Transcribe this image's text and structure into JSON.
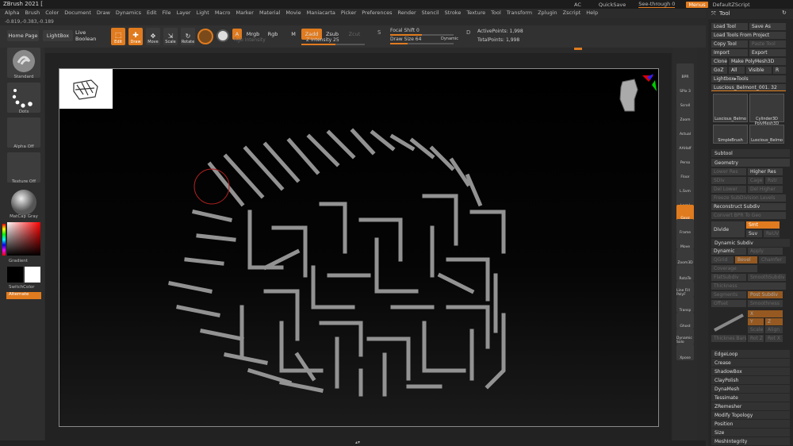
{
  "app": {
    "title": "ZBrush 2021 [",
    "coords": "-0.819,-0.383,-0.189"
  },
  "menus": [
    "Alpha",
    "Brush",
    "Color",
    "Document",
    "Draw",
    "Dynamics",
    "Edit",
    "File",
    "Layer",
    "Light",
    "Macro",
    "Marker",
    "Material",
    "Movie",
    "Maniacarta",
    "Picker",
    "Preferences",
    "Render",
    "Stencil",
    "Stroke",
    "Texture",
    "Tool",
    "Transform",
    "Zplugin",
    "Zscript",
    "Help"
  ],
  "topright": {
    "ac": "AC",
    "quicksave": "QuickSave",
    "seethrough": "See-through  0",
    "menus": "Menus",
    "script": "DefaultZScript"
  },
  "toolbar": {
    "home": "Home Page",
    "lightbox": "LightBox",
    "liveboolean": "Live Boolean",
    "edit": "Edit",
    "draw": "Draw",
    "move": "Move",
    "scale": "Scale",
    "rotate": "Rotate",
    "a": "A",
    "mrgb": "Mrgb",
    "rgb": "Rgb",
    "m": "M",
    "zadd": "Zadd",
    "zsub": "Zsub",
    "zcut": "Zcut",
    "rgb_intensity": "Rgb Intensity",
    "z_intensity": "Z Intensity 25",
    "focal_shift": "Focal Shift 0",
    "draw_size": "Draw Size 64",
    "dynamic": "Dynamic",
    "active_points": "ActivePoints: 1,998",
    "total_points": "TotalPoints: 1,998"
  },
  "leftshelf": {
    "standard": "Standard",
    "dots": "Dots",
    "alpha": "Alpha Off",
    "texture": "Texture Off",
    "matcap": "MatCap Gray",
    "gradient": "Gradient",
    "switchcolor": "SwitchColor",
    "alternate": "Alternate"
  },
  "rightshelf": [
    "BPR",
    "SPix 3",
    "Scroll",
    "Zoom",
    "Actual",
    "AAHalf",
    "Persp",
    "Floor",
    "L.Sym",
    "Local",
    "Gxyz",
    "Frame",
    "Move",
    "Zoom3D",
    "RotaTe",
    "Line Fill PolyF",
    "Transp",
    "Ghost",
    "Dynamic Solo",
    "Xpose"
  ],
  "toolpanel": {
    "header": "Tool",
    "load_tool": "Load Tool",
    "save_as": "Save As",
    "load_project": "Load Tools From Project",
    "copy_tool": "Copy Tool",
    "paste_tool": "Paste Tool",
    "import": "Import",
    "export": "Export",
    "clone": "Clone",
    "make_polymesh": "Make PolyMesh3D",
    "goz": "GoZ",
    "all": "All",
    "visible": "Visible",
    "r": "R",
    "lightbox_tools": "Lightbox▸Tools",
    "current_tool": "Luscious_Belmont_001. 32",
    "thumbs": [
      "Luscious_Belmo",
      "Cylinder3D",
      "PolyMesh3D",
      "SimpleBrush",
      "Luscious_Belmo"
    ],
    "subtool": "Subtool",
    "geometry": "Geometry",
    "lower_res": "Lower Res",
    "higher_res": "Higher Res",
    "sdiv": "SDiv",
    "cage": "Cage",
    "rstr": "Rstr",
    "del_lower": "Del Lower",
    "del_higher": "Del Higher",
    "freeze": "Freeze SubDivision Levels",
    "reconstruct": "Reconstruct Subdiv",
    "convert_bpr": "Convert BPR To Geo",
    "divide": "Divide",
    "smt": "Smt",
    "suv": "Suv",
    "reluv": "ReUV",
    "dynamic_subdiv": "Dynamic Subdiv",
    "dynamic": "Dynamic",
    "apply": "Apply",
    "qgrid": "QGrid",
    "bevel": "Bevel",
    "chamfer": "Chamfer",
    "coverage": "Coverage",
    "flat_subdiv": "FlatSubdiv",
    "smooth_subdiv": "SmoothSubdiv",
    "thickness": "Thickness",
    "segments": "Segments",
    "post_subdiv": "Post Subdiv",
    "offset": "Offset",
    "smoothness": "Smoothness",
    "x": "X",
    "y": "Y",
    "z": "Z",
    "scale": "Scale",
    "align": "Align",
    "rot_z": "Rot Z",
    "rot_x": "Rot X",
    "thicknessbars": "Thicknes Bars",
    "sections": [
      "EdgeLoop",
      "Crease",
      "ShadowBox",
      "ClayPolish",
      "DynaMesh",
      "Tessimate",
      "ZRemesher",
      "Modify Topology",
      "Position",
      "Size",
      "MeshIntegrity"
    ]
  },
  "colors": {
    "accent": "#e07b1f",
    "panel": "#262626",
    "canvas": "#000000"
  }
}
